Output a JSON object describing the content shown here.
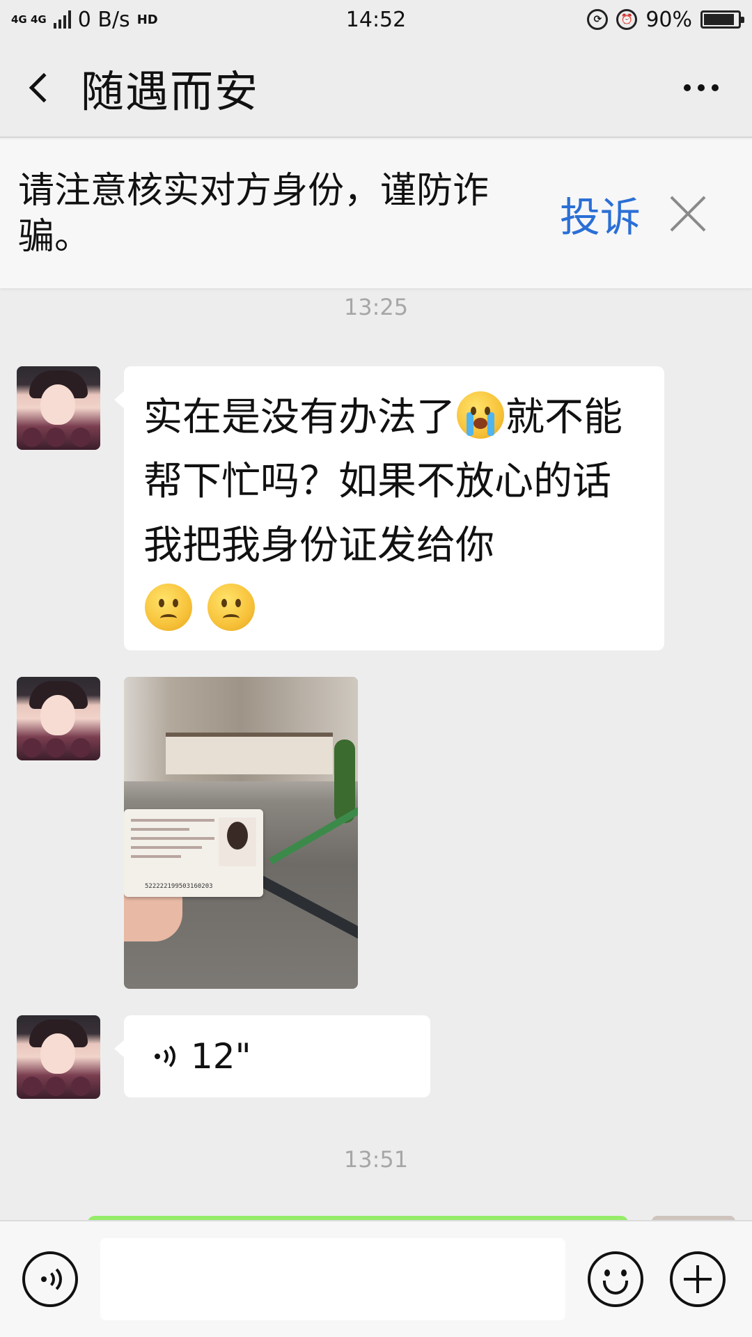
{
  "status_bar": {
    "network": "4G 4G",
    "speed": "0 B/s",
    "hd": "HD",
    "time": "14:52",
    "battery": "90%"
  },
  "header": {
    "title": "随遇而安"
  },
  "warning": {
    "text": "请注意核实对方身份，谨防诈骗。",
    "complain_label": "投诉"
  },
  "messages": {
    "time1": "13:25",
    "text1_part1": "实在是没有办法了",
    "text1_part2": "就不能帮下忙吗？如果不放心的话我把我身份证发给你",
    "id_card_number": "522222199503160203",
    "voice_duration": "12\"",
    "time2": "13:51"
  },
  "input": {
    "placeholder": ""
  },
  "colors": {
    "background": "#ededed",
    "link_blue": "#2b6fd6",
    "sent_green": "#95ec69"
  }
}
